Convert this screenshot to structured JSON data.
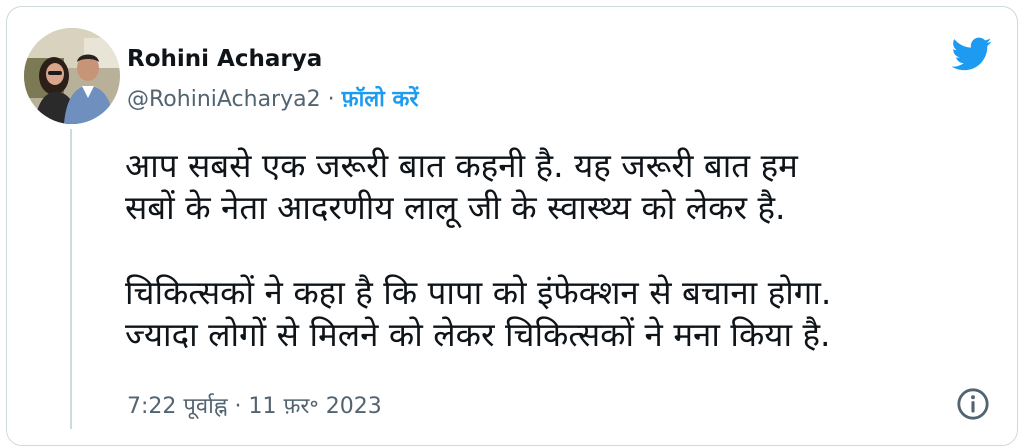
{
  "author": {
    "name": "Rohini Acharya",
    "handle": "@RohiniAcharya2",
    "separator": "·",
    "follow_label": "फ़ॉलो करें"
  },
  "tweet": {
    "lines": [
      "आप सबसे एक जरूरी बात कहनी है. यह जरूरी बात हम",
      "सबों के नेता आदरणीय लालू जी के स्वास्थ्य को लेकर है.",
      "चिकित्सकों ने कहा है कि पापा को इंफेक्शन से बचाना होगा.",
      "ज्यादा लोगों से मिलने को लेकर चिकित्सकों ने मना किया है."
    ]
  },
  "footer": {
    "timestamp": "7:22 पूर्वाह्न · 11 फ़र॰ 2023"
  },
  "icons": {
    "brand": "twitter-bird-icon",
    "info": "info-icon"
  },
  "colors": {
    "accent": "#1d9bf0",
    "text": "#0f1419",
    "muted": "#536471",
    "border": "#cfd9de"
  }
}
